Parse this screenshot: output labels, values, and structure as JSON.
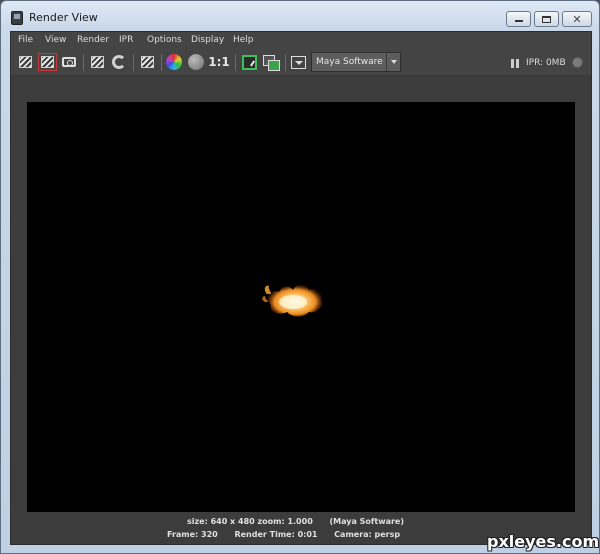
{
  "window": {
    "title": "Render View"
  },
  "menubar": {
    "items": [
      "File",
      "View",
      "Render",
      "IPR",
      "Options",
      "Display",
      "Help"
    ]
  },
  "toolbar": {
    "ratio_label": "1:1",
    "renderer": {
      "value": "Maya Software"
    },
    "ipr_status": "IPR: 0MB",
    "icons": [
      "render-clapper-icon",
      "render-region-icon",
      "snapshot-camera-icon",
      "ipr-render-icon",
      "refresh-icon",
      "render-settings-icon",
      "rgb-channel-icon",
      "alpha-channel-icon",
      "real-size-icon",
      "keep-image-icon",
      "remove-image-icon",
      "renderer-options-icon",
      "pause-ipr-icon"
    ]
  },
  "status": {
    "line1": "size: 640 x 480 zoom: 1.000      (Maya Software)",
    "line2": "Frame: 320      Render Time: 0:01      Camera: persp"
  },
  "watermark": "pxleyes.com",
  "colors": {
    "background": "#000000",
    "ui": "#444444",
    "flame": "#f5a623"
  }
}
